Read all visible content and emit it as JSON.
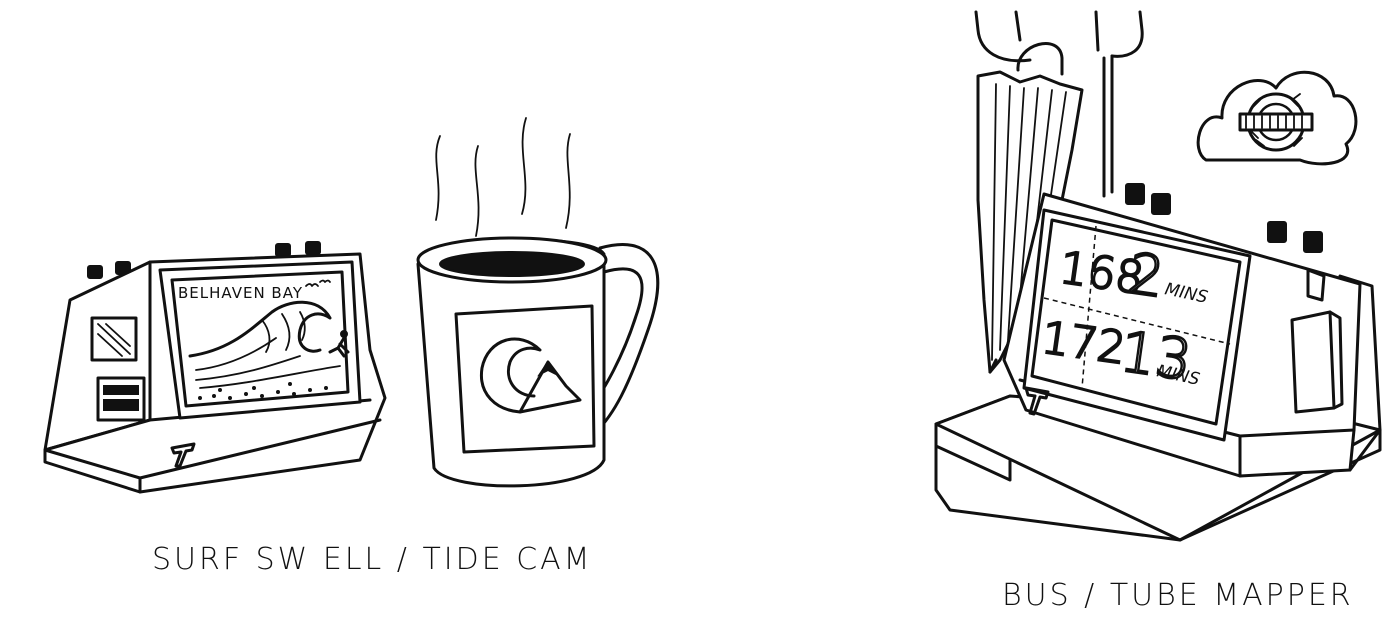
{
  "captions": {
    "left": "SURF SW ELL / TIDE CAM",
    "right": "BUS / TUBE MAPPER"
  },
  "surf_device": {
    "screen_title": "BELHAVEN BAY",
    "logo_icon": "t-logo-icon"
  },
  "mug": {
    "emblem_icon": "wave-mountain-icon"
  },
  "bus_device": {
    "logo_icon": "t-logo-icon",
    "departures": [
      {
        "route": "168",
        "eta_number": "2",
        "eta_unit": "MINS"
      },
      {
        "route": "172",
        "eta_number": "13",
        "eta_unit": "MINS"
      }
    ]
  },
  "underground_sign": {
    "icon": "underground-roundel-icon"
  }
}
